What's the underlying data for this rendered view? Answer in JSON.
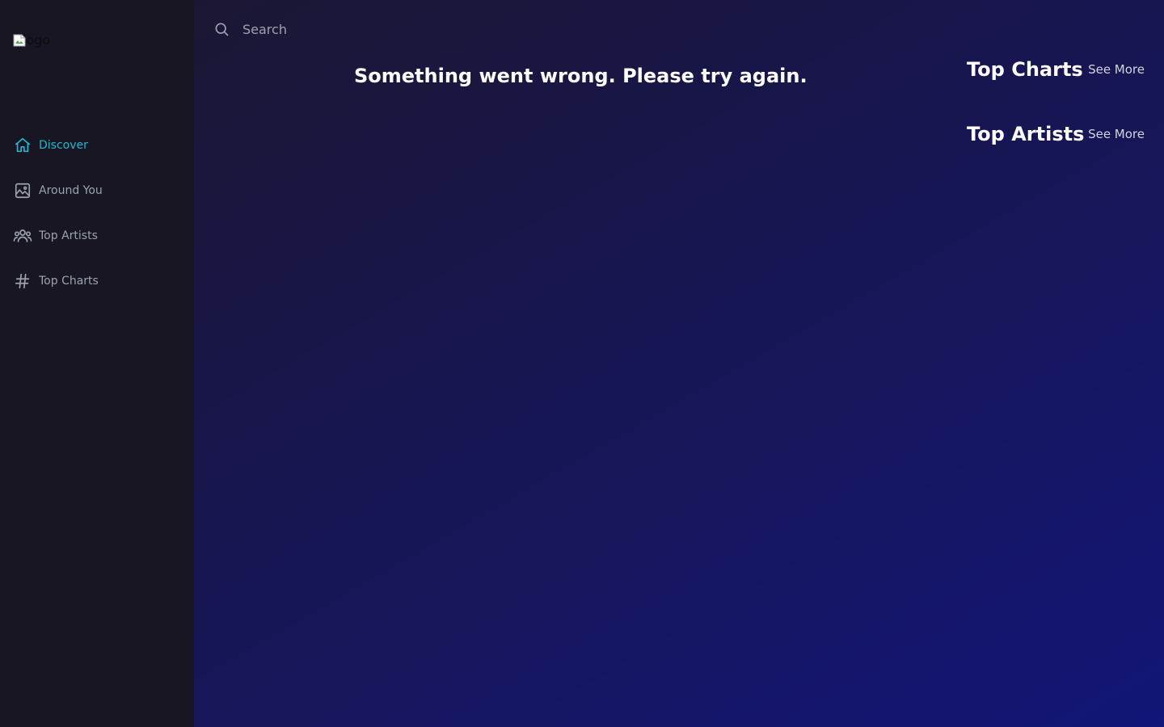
{
  "sidebar": {
    "logo_alt": "logo",
    "items": [
      {
        "label": "Discover",
        "icon": "home-icon",
        "active": true
      },
      {
        "label": "Around You",
        "icon": "image-icon",
        "active": false
      },
      {
        "label": "Top Artists",
        "icon": "user-group-icon",
        "active": false
      },
      {
        "label": "Top Charts",
        "icon": "hashtag-icon",
        "active": false
      }
    ]
  },
  "search": {
    "placeholder": "Search",
    "value": ""
  },
  "main": {
    "error_message": "Something went wrong. Please try again."
  },
  "top_charts": {
    "title": "Top Charts",
    "see_more": "See More"
  },
  "top_artists": {
    "title": "Top Artists",
    "see_more": "See More"
  },
  "colors": {
    "sidebar_bg": "#191624",
    "accent": "#22b8cf",
    "nav_text": "#9ca3af",
    "heading": "#ffffff"
  }
}
